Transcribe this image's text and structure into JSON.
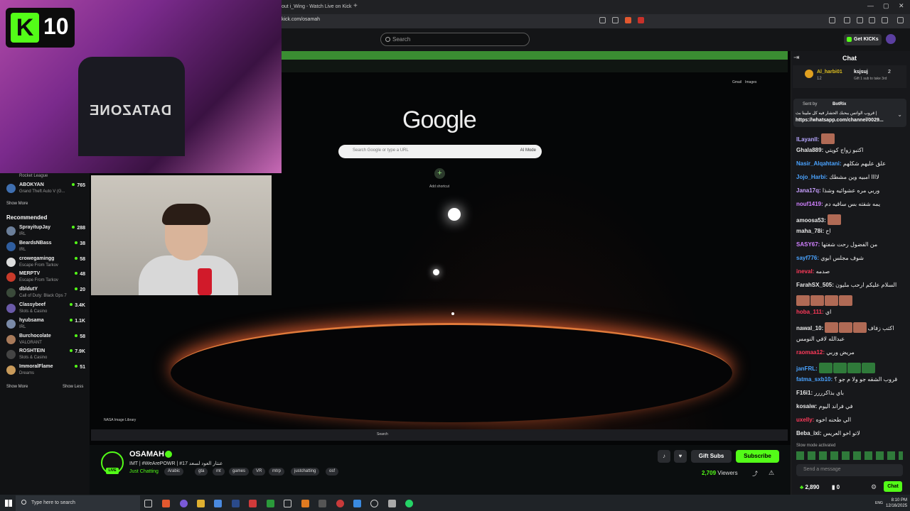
{
  "browser": {
    "tab_title": "out i_Wing - Watch Live on Kick",
    "new_tab_label": "+",
    "url": "kick.com/osamah"
  },
  "kick": {
    "search_placeholder": "Search",
    "get_kicks_label": "Get KICKs",
    "badge_number": "10",
    "badge_letter": "K"
  },
  "sidebar": {
    "partial_category": "Rocket League",
    "following": [
      {
        "name": "ABOKYAN",
        "category": "Grand Theft Auto V (G...",
        "viewers": "765",
        "color": "#3f6fb0"
      }
    ],
    "show_more_label": "Show More",
    "recommended_label": "Recommended",
    "recommended": [
      {
        "name": "SprayitupJay",
        "category": "IRL",
        "viewers": "288",
        "color": "#6b7f9a"
      },
      {
        "name": "BeardsNBass",
        "category": "IRL",
        "viewers": "38",
        "color": "#2f5d9e"
      },
      {
        "name": "crowegamingg",
        "category": "Escape From Tarkov",
        "viewers": "58",
        "color": "#dddddd"
      },
      {
        "name": "MERPTV",
        "category": "Escape From Tarkov",
        "viewers": "48",
        "color": "#c83a2a"
      },
      {
        "name": "dbldutY",
        "category": "Call of Duty: Black Ops 7",
        "viewers": "20",
        "color": "#3a4a3a"
      },
      {
        "name": "Classybeef",
        "category": "Slots & Casino",
        "viewers": "3.4K",
        "color": "#6a5aa8"
      },
      {
        "name": "hyubsama",
        "category": "IRL",
        "viewers": "1.1K",
        "color": "#7a8aa8"
      },
      {
        "name": "Burchocolate",
        "category": "VALORANT",
        "viewers": "58",
        "color": "#a87a5a"
      },
      {
        "name": "ROSHTEIN",
        "category": "Slots & Casino",
        "viewers": "7.9K",
        "color": "#444444"
      },
      {
        "name": "ImmoralFlame",
        "category": "Dreams",
        "viewers": "51",
        "color": "#c89a5a"
      }
    ],
    "show_more_label2": "Show More",
    "show_less_label": "Show Less"
  },
  "stream_overlay": {
    "google_logo": "Google",
    "google_search_placeholder": "Search Google or type a URL",
    "ai_mode_label": "AI Mode",
    "add_shortcut_label": "Add shortcut",
    "gmail_label": "Gmail",
    "images_label": "Images",
    "credit": "NASA Image Library",
    "datazone_text": "DATAZONE",
    "inner_search": "Search"
  },
  "channel": {
    "name": "OSAMAH",
    "title": "IMT | #WeArePOWR | #17 عنتار العود لسعد",
    "category": "Just Chatting",
    "live_label": "LIVE",
    "tags": [
      "Arabic",
      "gta",
      "mt",
      "games",
      "VR",
      "mtrp",
      "justchatting",
      "osf"
    ],
    "gift_subs_label": "Gift Subs",
    "subscribe_label": "Subscribe",
    "viewers_count": "2,709",
    "viewers_label": "Viewers"
  },
  "chat": {
    "title": "Chat",
    "pinned_user1": "Al_harbi01",
    "pinned_user1_count": "12",
    "pinned_user2": "ksjsuj",
    "pinned_user2_count": "2",
    "pinned_sub_text": "Gift 1 sub to take 3rd",
    "sent_by_label": "Sent by",
    "sent_by_user": "BotRix",
    "sent_by_msg": "قروب الواتس يبحبك الحشار فيه كل مليينا بث |",
    "sent_by_link": "https://whatsapp.com/channel/0029...",
    "messages": [
      {
        "user": "lLayanll:",
        "text": "",
        "color": "#b6a6ff",
        "emotes": 1
      },
      {
        "user": "Ghala889:",
        "text": "اكتبو زواج كويتي",
        "color": "#e8e8e8",
        "emotes": 0
      },
      {
        "user": "Nasir_Alqahtani:",
        "text": "علق عليهم شكلهم",
        "color": "#4aa3ff",
        "emotes": 0
      },
      {
        "user": "Jojo_Harbi:",
        "text": "لاااا امبيه وين مشطك",
        "color": "#4aa3ff",
        "emotes": 0
      },
      {
        "user": "Jana17q:",
        "text": "وربي مره عشوائيه وشذا",
        "color": "#c8a0ff",
        "emotes": 0
      },
      {
        "user": "nouf1419:",
        "text": "يمه شفته بس ساقيه دم",
        "color": "#d080ff",
        "emotes": 0
      },
      {
        "user": "amoosa53:",
        "text": "",
        "color": "#e8e8e8",
        "emotes": 1
      },
      {
        "user": "maha_78i:",
        "text": "اح",
        "color": "#e8e8e8",
        "emotes": 0
      },
      {
        "user": "SASY67:",
        "text": "من الفضول رحت شفتها",
        "color": "#d080ff",
        "emotes": 0
      },
      {
        "user": "sayf776:",
        "text": "شوف مجلس ابوي",
        "color": "#4aa3ff",
        "emotes": 0
      },
      {
        "user": "ineval:",
        "text": "صدمه",
        "color": "#ff3a5a",
        "emotes": 0
      },
      {
        "user": "FarahSX_505:",
        "text": "السلام عليكم ارحب مليون",
        "color": "#e8e8e8",
        "emotes": 0
      },
      {
        "user": "",
        "text": "",
        "color": "#e8e8e8",
        "emotes": 4
      },
      {
        "user": "hoba_111:",
        "text": "اي",
        "color": "#ff3a5a",
        "emotes": 0
      },
      {
        "user": "nawal_10:",
        "text": "اكتب زفاف",
        "color": "#e8e8e8",
        "emotes": 3
      },
      {
        "user": "",
        "text": "عبدالله لافي النومس",
        "color": "#e8e8e8",
        "emotes": 0
      },
      {
        "user": "raomaa12:",
        "text": "مريض وربي",
        "color": "#ff3a5a",
        "emotes": 0
      },
      {
        "user": "janFRL:",
        "text": "",
        "color": "#4aa3ff",
        "emotes": 4
      },
      {
        "user": "fatma_sxb10:",
        "text": "قروب الشقه جو ولا م جو ؟",
        "color": "#4aa3ff",
        "emotes": 0
      },
      {
        "user": "F16i1:",
        "text": "باي بذاكرررر",
        "color": "#e8e8e8",
        "emotes": 0
      },
      {
        "user": "kosaiw:",
        "text": "في فراند اليوم",
        "color": "#e8e8e8",
        "emotes": 0
      },
      {
        "user": "uxelly:",
        "text": "الي طحنه اخوه",
        "color": "#ff3a5a",
        "emotes": 0
      },
      {
        "user": "Beba_ixi:",
        "text": "لاتو اخو العريس",
        "color": "#e8e8e8",
        "emotes": 0
      }
    ],
    "slow_mode_text": "Slow mode activated",
    "input_placeholder": "Send a message",
    "kicks_count": "2,890",
    "points_count": "0",
    "chat_button": "Chat"
  },
  "windows": {
    "search_placeholder": "Type here to search",
    "lang": "ENG",
    "time": "8:10 PM",
    "date": "12/16/2025"
  }
}
